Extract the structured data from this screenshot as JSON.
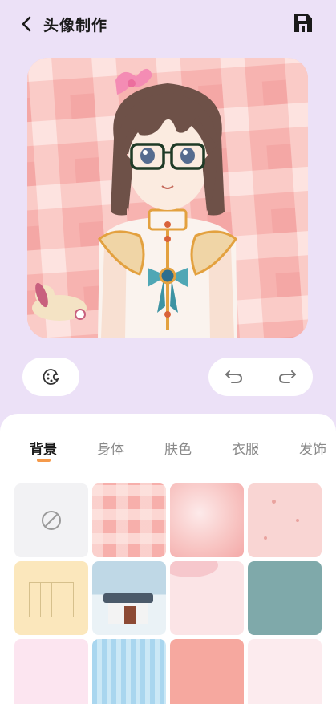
{
  "header": {
    "title": "头像制作",
    "back_icon": "chevron-left-icon",
    "save_icon": "save-icon"
  },
  "toolbar": {
    "palette_icon": "palette-icon",
    "undo_icon": "undo-icon",
    "redo_icon": "redo-icon"
  },
  "tabs": [
    {
      "label": "背景",
      "active": true
    },
    {
      "label": "身体",
      "active": false
    },
    {
      "label": "肤色",
      "active": false
    },
    {
      "label": "衣服",
      "active": false
    },
    {
      "label": "发饰",
      "active": false
    }
  ],
  "colors": {
    "accent": "#F59A4B",
    "page_bg": "#ECE1F7",
    "canvas_pink": "#F6B8B5"
  },
  "backgrounds": [
    {
      "name": "none",
      "icon": "no-entry-icon"
    },
    {
      "name": "pink-plaid"
    },
    {
      "name": "pink-watercolor"
    },
    {
      "name": "pink-dots"
    },
    {
      "name": "yellow-grid-paper"
    },
    {
      "name": "snowy-house"
    },
    {
      "name": "pink-petals"
    },
    {
      "name": "teal-texture"
    },
    {
      "name": "bunny-pattern"
    },
    {
      "name": "blue-stripes"
    },
    {
      "name": "pink-floral"
    },
    {
      "name": "flower-field"
    }
  ]
}
